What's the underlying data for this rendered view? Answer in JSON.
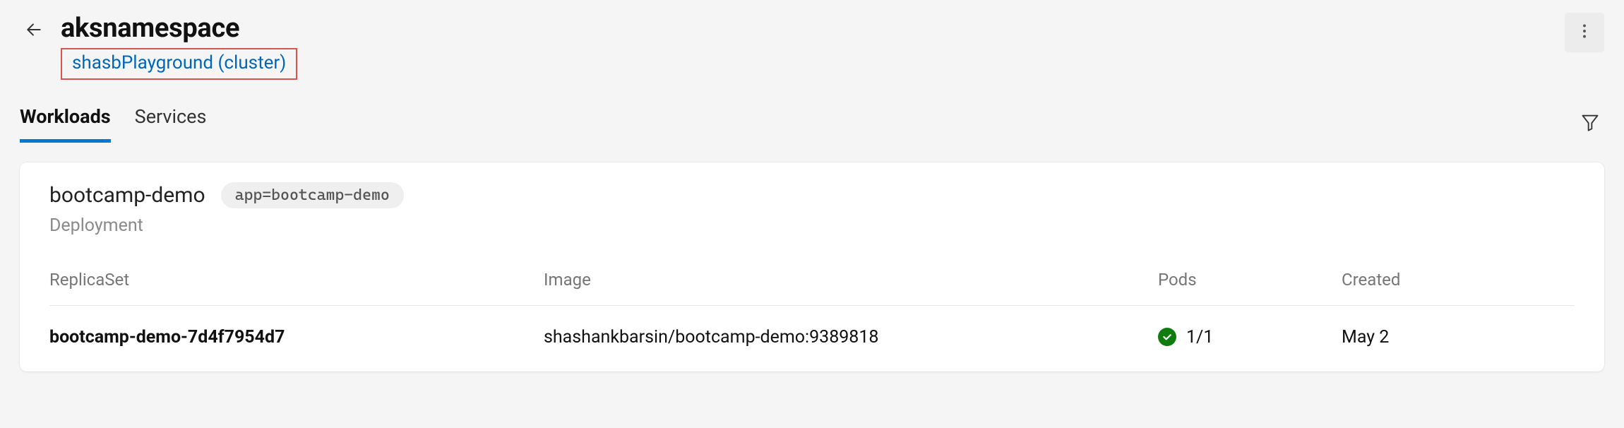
{
  "header": {
    "title": "aksnamespace",
    "breadcrumb": "shasbPlayground (cluster)"
  },
  "tabs": {
    "workloads": "Workloads",
    "services": "Services"
  },
  "workload": {
    "name": "bootcamp-demo",
    "label_pill": "app=bootcamp-demo",
    "kind": "Deployment"
  },
  "columns": {
    "replicaset": "ReplicaSet",
    "image": "Image",
    "pods": "Pods",
    "created": "Created"
  },
  "row": {
    "name": "bootcamp-demo-7d4f7954d7",
    "image": "shashankbarsin/bootcamp-demo:9389818",
    "pods": "1/1",
    "created": "May 2"
  }
}
